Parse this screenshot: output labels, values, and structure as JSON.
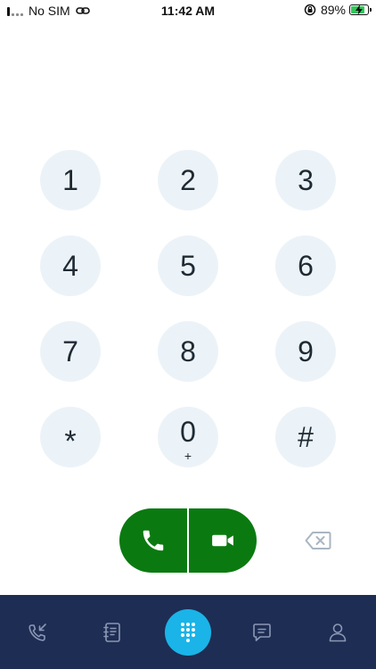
{
  "status_bar": {
    "carrier": "No SIM",
    "time": "11:42 AM",
    "battery_percent": "89%",
    "battery_level": 0.89
  },
  "keypad": {
    "keys": [
      {
        "digit": "1",
        "sub": ""
      },
      {
        "digit": "2",
        "sub": ""
      },
      {
        "digit": "3",
        "sub": ""
      },
      {
        "digit": "4",
        "sub": ""
      },
      {
        "digit": "5",
        "sub": ""
      },
      {
        "digit": "6",
        "sub": ""
      },
      {
        "digit": "7",
        "sub": ""
      },
      {
        "digit": "8",
        "sub": ""
      },
      {
        "digit": "9",
        "sub": ""
      },
      {
        "digit": "*",
        "sub": ""
      },
      {
        "digit": "0",
        "sub": "+"
      },
      {
        "digit": "#",
        "sub": ""
      }
    ]
  },
  "actions": {
    "call_icon": "phone-icon",
    "video_icon": "video-camera-icon",
    "backspace_icon": "backspace-icon"
  },
  "bottom_nav": {
    "items": [
      {
        "name": "recent-calls",
        "icon": "recent-calls-icon"
      },
      {
        "name": "contacts",
        "icon": "contacts-book-icon"
      },
      {
        "name": "dialpad",
        "icon": "dialpad-icon",
        "active": true
      },
      {
        "name": "messages",
        "icon": "chat-icon"
      },
      {
        "name": "profile",
        "icon": "person-icon"
      }
    ]
  },
  "colors": {
    "key_background": "#ecf3f8",
    "call_green": "#0a7a10",
    "nav_background": "#1e2d54",
    "active_accent": "#1ab4e8",
    "nav_icon": "#8b97b4"
  }
}
